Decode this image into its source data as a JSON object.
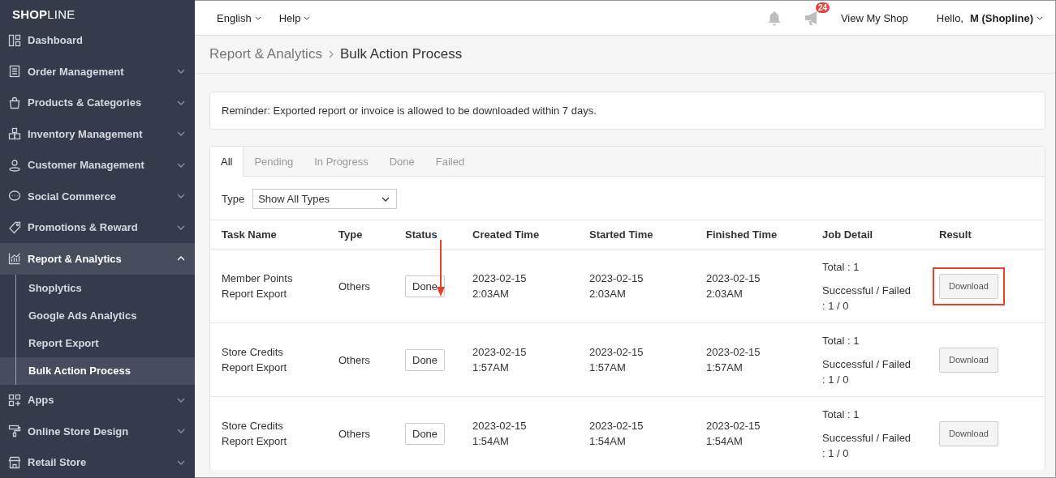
{
  "logo": {
    "bold": "SHOP",
    "light": "LINE"
  },
  "sidebar": {
    "items": [
      {
        "label": "Dashboard",
        "expandable": false,
        "expanded": false,
        "selected": false
      },
      {
        "label": "Order Management",
        "expandable": true,
        "expanded": false,
        "selected": false
      },
      {
        "label": "Products & Categories",
        "expandable": true,
        "expanded": false,
        "selected": false
      },
      {
        "label": "Inventory Management",
        "expandable": true,
        "expanded": false,
        "selected": false
      },
      {
        "label": "Customer Management",
        "expandable": true,
        "expanded": false,
        "selected": false
      },
      {
        "label": "Social Commerce",
        "expandable": true,
        "expanded": false,
        "selected": false
      },
      {
        "label": "Promotions & Reward",
        "expandable": true,
        "expanded": false,
        "selected": false
      },
      {
        "label": "Report & Analytics",
        "expandable": true,
        "expanded": true,
        "selected": true,
        "children": [
          {
            "label": "Shoplytics",
            "selected": false
          },
          {
            "label": "Google Ads Analytics",
            "selected": false
          },
          {
            "label": "Report Export",
            "selected": false
          },
          {
            "label": "Bulk Action Process",
            "selected": true
          }
        ]
      },
      {
        "label": "Apps",
        "expandable": true,
        "expanded": false,
        "selected": false
      },
      {
        "label": "Online Store Design",
        "expandable": true,
        "expanded": false,
        "selected": false
      },
      {
        "label": "Retail Store",
        "expandable": true,
        "expanded": false,
        "selected": false
      }
    ]
  },
  "topbar": {
    "menus": [
      "English",
      "Help"
    ],
    "notification_badge": "24",
    "view_shop": "View My Shop",
    "greeting": "Hello,",
    "user": "M (Shopline)"
  },
  "breadcrumb": {
    "parent": "Report & Analytics",
    "current": "Bulk Action Process"
  },
  "reminder": "Reminder: Exported report or invoice is allowed to be downloaded within 7 days.",
  "tabs": [
    {
      "label": "All",
      "selected": true
    },
    {
      "label": "Pending",
      "selected": false
    },
    {
      "label": "In Progress",
      "selected": false
    },
    {
      "label": "Done",
      "selected": false
    },
    {
      "label": "Failed",
      "selected": false
    }
  ],
  "filter": {
    "label": "Type",
    "value": "Show All Types"
  },
  "table": {
    "columns": [
      "Task Name",
      "Type",
      "Status",
      "Created Time",
      "Started Time",
      "Finished Time",
      "Job Detail",
      "Result"
    ],
    "rows": [
      {
        "task_name": "Member Points Report Export",
        "type": "Others",
        "status": "Done",
        "created": "2023-02-15 2:03AM",
        "started": "2023-02-15 2:03AM",
        "finished": "2023-02-15 2:03AM",
        "total": "Total : 1",
        "result_label": "Successful / Failed",
        "result_counts": ": 1 / 0",
        "action": "Download",
        "highlighted": true
      },
      {
        "task_name": "Store Credits Report Export",
        "type": "Others",
        "status": "Done",
        "created": "2023-02-15 1:57AM",
        "started": "2023-02-15 1:57AM",
        "finished": "2023-02-15 1:57AM",
        "total": "Total : 1",
        "result_label": "Successful / Failed",
        "result_counts": ": 1 / 0",
        "action": "Download",
        "highlighted": false
      },
      {
        "task_name": "Store Credits Report Export",
        "type": "Others",
        "status": "Done",
        "created": "2023-02-15 1:54AM",
        "started": "2023-02-15 1:54AM",
        "finished": "2023-02-15 1:54AM",
        "total": "Total : 1",
        "result_label": "Successful / Failed",
        "result_counts": ": 1 / 0",
        "action": "Download",
        "highlighted": false
      }
    ]
  }
}
